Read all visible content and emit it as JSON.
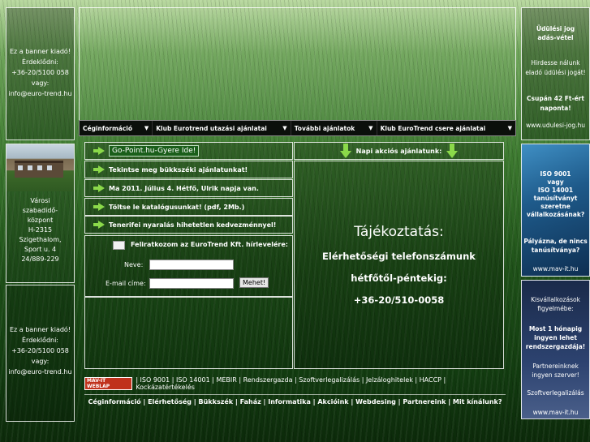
{
  "left_banner_top": {
    "lines": [
      "Ez a banner kiadó!",
      "Érdeklődni:",
      "+36-20/5100 058",
      "vagy:",
      "info@euro-trend.hu"
    ]
  },
  "left_city": {
    "lines": [
      "Városi",
      "szabadidő-",
      "központ",
      "H-2315",
      "Szigethalom,",
      "Sport u. 4",
      "24/889-229"
    ]
  },
  "left_banner_bottom": {
    "lines": [
      "Ez a banner kiadó!",
      "Érdeklődni:",
      "+36-20/5100 058",
      "vagy:",
      "info@euro-trend.hu"
    ]
  },
  "nav": {
    "items": [
      {
        "label": "Céginformáció"
      },
      {
        "label": "Klub Eurotrend utazási ajánlatai"
      },
      {
        "label": "További ajánlatok"
      },
      {
        "label": "Klub EuroTrend csere ajánlatai"
      }
    ]
  },
  "news": {
    "items": [
      "Go-Point.hu-Gyere Ide!",
      "Tekintse meg bükkszéki ajánlatunkat!",
      "Ma 2011. Július 4. Hétfő, Ulrik napja van.",
      "Töltse le katalógusunkat! (pdf, 2Mb.)",
      "Tenerifei nyaralás hihetetlen kedvezménnyel!"
    ]
  },
  "newsletter": {
    "title": "Feliratkozom az EuroTrend Kft. hírlevelére:",
    "name_label": "Neve:",
    "email_label": "E-mail címe:",
    "submit": "Mehet!"
  },
  "daily_offers": {
    "title": "Napi akciós ajánlatunk:"
  },
  "info": {
    "heading": "Tájékoztatás:",
    "line1": "Elérhetőségi telefonszámunk",
    "line2": "hétfőtől-péntekig:",
    "phone": "+36-20/510-0058"
  },
  "right_top": {
    "title1": "Üdülési jog",
    "title2": "adás-vétel",
    "body1": "Hirdesse nálunk",
    "body2": "eladó üdülési jogát!",
    "price1": "Csupán 42 Ft-ért",
    "price2": "naponta!",
    "url": "www.udulesi-jog.hu"
  },
  "right_iso": {
    "lines": [
      "ISO 9001",
      "vagy",
      "ISO 14001",
      "tanúsítványt",
      "szeretne",
      "vállalkozásának?"
    ],
    "question": [
      "Pályázna, de nincs",
      "tanúsítványa?"
    ],
    "url": "www.mav-it.hu"
  },
  "right_bottom": {
    "lines": [
      "Kisvállalkozások",
      "figyelmébe:"
    ],
    "bold": [
      "Most 1 hónapig",
      "ingyen lehet",
      "rendszergazdája!"
    ],
    "extra": [
      "Partnereinknek",
      "ingyen szerver!"
    ],
    "service": "Szoftverlegalizálás",
    "url": "www.mav-it.hu"
  },
  "footer": {
    "badge": "MAV-IT WEBLAP",
    "links1": "| ISO 9001 | ISO 14001 | MEBIR | Rendszergazda | Szoftverlegalizálás | Jelzáloghitelek | HACCP | Kockázatértékelés",
    "links2": "Céginformáció | Elérhetőség | Bükkszék | Faház | Informatika | Akcióink | Webdesing | Partnereink | Mit kínálunk?"
  },
  "colors": {
    "accent_green": "#8bd94a",
    "nav_bg": "#0b0f0b",
    "iso_panel": "#1e5a8a"
  }
}
